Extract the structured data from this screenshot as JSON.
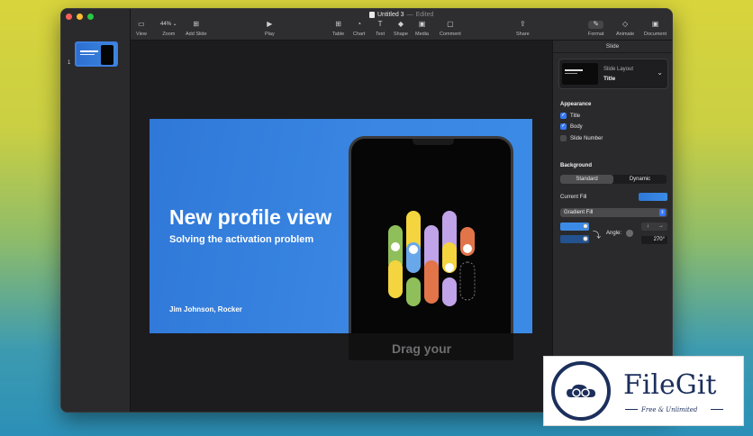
{
  "window": {
    "doc_title": "Untitled 3",
    "separator": "—",
    "status": "Edited"
  },
  "sidebar": {
    "slides": [
      {
        "number": "1"
      }
    ]
  },
  "toolbar": {
    "view": "View",
    "zoom_value": "44% ⌄",
    "zoom": "Zoom",
    "add_slide": "Add Slide",
    "play": "Play",
    "table": "Table",
    "chart": "Chart",
    "text": "Text",
    "shape": "Shape",
    "media": "Media",
    "comment": "Comment",
    "share": "Share",
    "format": "Format",
    "animate": "Animate",
    "document": "Document"
  },
  "slide": {
    "title": "New profile view",
    "subtitle": "Solving the activation problem",
    "author": "Jim Johnson, Rocker",
    "overflow_text": "Drag your"
  },
  "inspector": {
    "tab": "Slide",
    "layout_label": "Slide Layout",
    "layout_value": "Title",
    "appearance_title": "Appearance",
    "appearance_options": [
      {
        "label": "Title",
        "checked": true
      },
      {
        "label": "Body",
        "checked": true
      },
      {
        "label": "Slide Number",
        "checked": false
      }
    ],
    "background_title": "Background",
    "background_modes": [
      "Standard",
      "Dynamic"
    ],
    "background_selected": "Standard",
    "current_fill_label": "Current Fill",
    "fill_type": "Gradient Fill",
    "angle_label": "Angle:",
    "angle_value": "270°",
    "colors": {
      "accent": "#3478f6",
      "gradient_start": "#2f78d8",
      "gradient_end": "#3b8be6"
    }
  },
  "watermark": {
    "name": "FileGit",
    "tagline": "Free & Unlimited"
  }
}
